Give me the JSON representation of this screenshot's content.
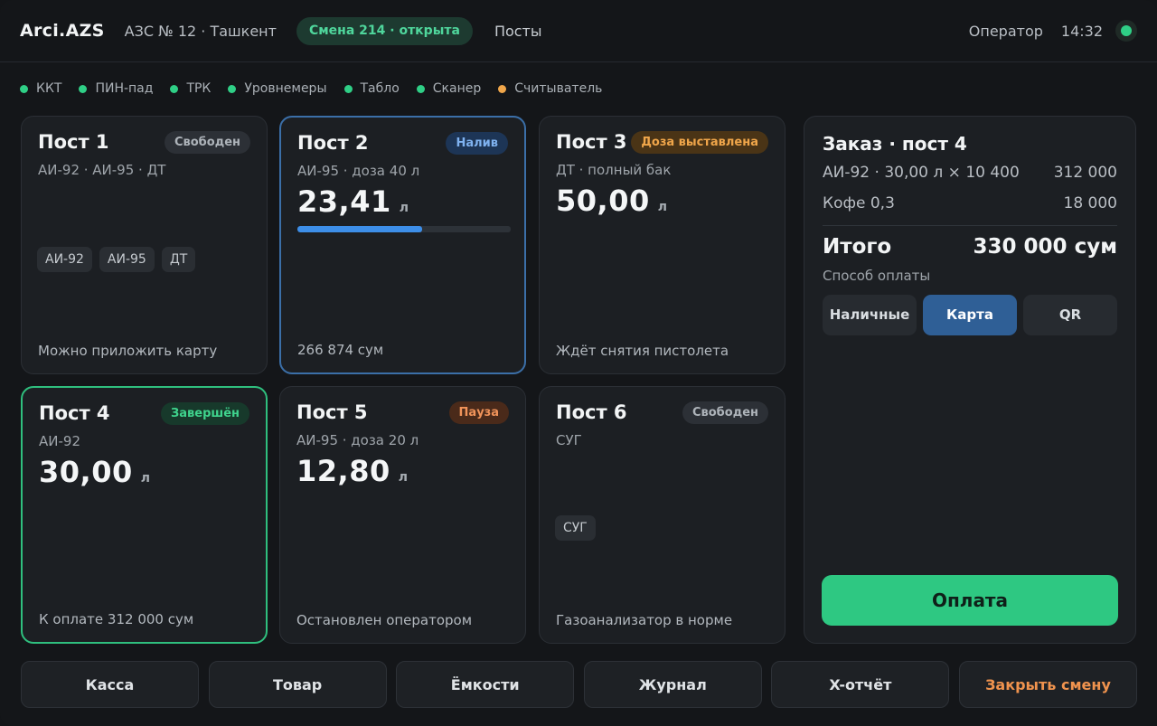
{
  "header": {
    "brand": "Arci.AZS",
    "station": "АЗС № 12 · Ташкент",
    "shift": "Смена 214 · открыта",
    "nav_posts": "Посты",
    "operator": "Оператор",
    "time": "14:32",
    "status_color": "#2fcf86"
  },
  "devices": [
    {
      "label": "ККТ",
      "status": "ok",
      "color": "#2fcf86"
    },
    {
      "label": "ПИН-пад",
      "status": "ok",
      "color": "#2fcf86"
    },
    {
      "label": "ТРК",
      "status": "ok",
      "color": "#2fcf86"
    },
    {
      "label": "Уровнемеры",
      "status": "ok",
      "color": "#2fcf86"
    },
    {
      "label": "Табло",
      "status": "ok",
      "color": "#2fcf86"
    },
    {
      "label": "Сканер",
      "status": "ok",
      "color": "#2fcf86"
    },
    {
      "label": "Считыватель",
      "status": "warning",
      "color": "#f0a64a"
    }
  ],
  "posts": [
    {
      "title": "Пост 1",
      "badge": "Свободен",
      "badge_type": "free",
      "sub": "АИ-92 · АИ-95 · ДТ",
      "chips": [
        "АИ-92",
        "АИ-95",
        "ДТ"
      ],
      "footer": "Можно приложить карту"
    },
    {
      "title": "Пост 2",
      "badge": "Налив",
      "badge_type": "pour",
      "sub": "АИ-95 · доза 40 л",
      "volume": "23,41",
      "unit": "л",
      "progress": 0.585,
      "footer": "266 874 сум"
    },
    {
      "title": "Пост 3",
      "badge": "Доза выставлена",
      "badge_type": "dose",
      "sub": "ДТ · полный бак",
      "volume": "50,00",
      "unit": "л",
      "footer": "Ждёт снятия пистолета"
    },
    {
      "title": "Пост 4",
      "badge": "Завершён",
      "badge_type": "done",
      "sub": "АИ-92",
      "volume": "30,00",
      "unit": "л",
      "footer": "К оплате 312 000 сум"
    },
    {
      "title": "Пост 5",
      "badge": "Пауза",
      "badge_type": "pause",
      "sub": "АИ-95 · доза 20 л",
      "volume": "12,80",
      "unit": "л",
      "footer": "Остановлен оператором"
    },
    {
      "title": "Пост 6",
      "badge": "Свободен",
      "badge_type": "free",
      "sub": "СУГ",
      "chips": [
        "СУГ"
      ],
      "footer": "Газоанализатор в норме"
    }
  ],
  "order": {
    "title": "Заказ · пост 4",
    "lines": [
      {
        "name": "АИ-92 · 30,00 л × 10 400",
        "amount": "312 000"
      },
      {
        "name": "Кофе 0,3",
        "amount": "18 000"
      }
    ],
    "total_label": "Итого",
    "total_value": "330 000 сум",
    "payment_label": "Способ оплаты",
    "payment_methods": [
      {
        "label": "Наличные",
        "selected": false
      },
      {
        "label": "Карта",
        "selected": true
      },
      {
        "label": "QR",
        "selected": false
      }
    ],
    "pay_button": "Оплата"
  },
  "bottom_actions": [
    {
      "label": "Касса"
    },
    {
      "label": "Товар"
    },
    {
      "label": "Ёмкости"
    },
    {
      "label": "Журнал"
    },
    {
      "label": "X-отчёт"
    },
    {
      "label": "Закрыть смену"
    }
  ]
}
